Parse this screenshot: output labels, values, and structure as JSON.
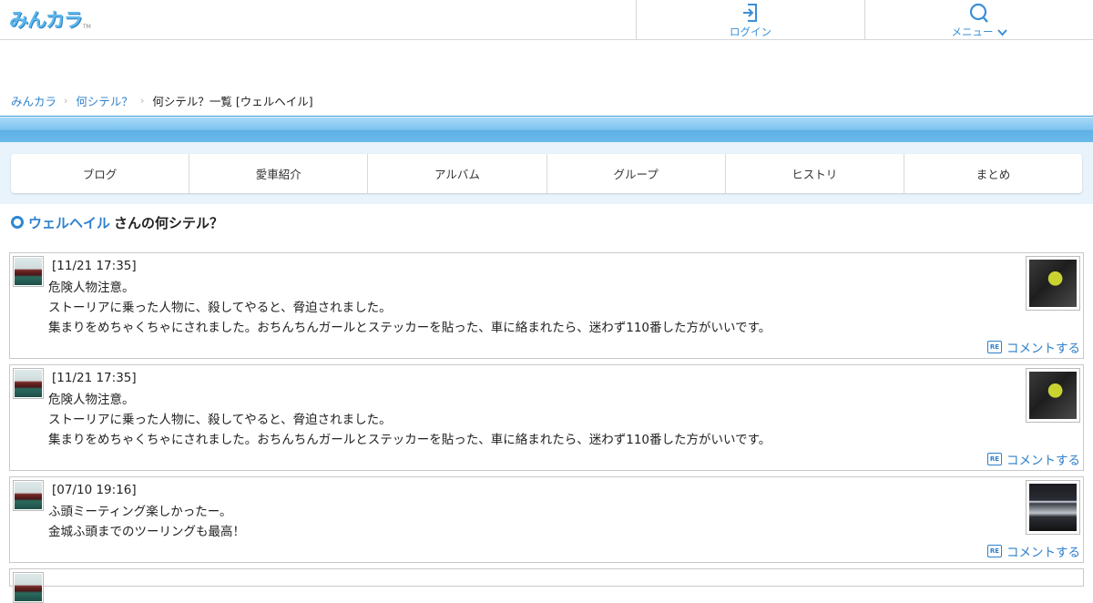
{
  "header": {
    "logo_text": "みんカラ",
    "logo_tm": "TM",
    "login_label": "ログイン",
    "menu_label": "メニュー"
  },
  "breadcrumb": {
    "items": [
      "みんカラ",
      "何シテル？"
    ],
    "current": "何シテル？一覧 [ウェルヘイル]"
  },
  "tabs": [
    "ブログ",
    "愛車紹介",
    "アルバム",
    "グループ",
    "ヒストリ",
    "まとめ"
  ],
  "section": {
    "user": "ウェルヘイル",
    "suffix": "さんの何シテル？"
  },
  "posts": [
    {
      "date": "[11/21 17:35]",
      "lines": [
        "危険人物注意。",
        "ストーリアに乗った人物に、殺してやると、脅迫されました。",
        "集まりをめちゃくちゃにされました。おちんちんガールとステッカーを貼った、車に絡まれたら、迷わず110番した方がいいです。"
      ],
      "comment_label": "コメントする"
    },
    {
      "date": "[11/21 17:35]",
      "lines": [
        "危険人物注意。",
        "ストーリアに乗った人物に、殺してやると、脅迫されました。",
        "集まりをめちゃくちゃにされました。おちんちんガールとステッカーを貼った、車に絡まれたら、迷わず110番した方がいいです。"
      ],
      "comment_label": "コメントする"
    },
    {
      "date": "[07/10 19:16]",
      "lines": [
        "ふ頭ミーティング楽しかったー。",
        "金城ふ頭までのツーリングも最高！"
      ],
      "comment_label": "コメントする"
    }
  ],
  "icons": {
    "login": "login-icon",
    "menu": "search-icon",
    "comment": "re-icon",
    "re_text": "RE"
  },
  "colors": {
    "link": "#2f80cc",
    "band": "#6ab9ea",
    "band_bg": "#e8f3fb"
  }
}
